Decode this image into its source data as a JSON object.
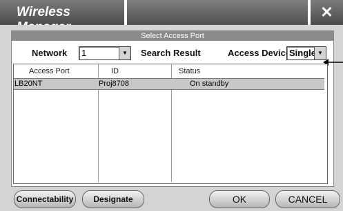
{
  "window": {
    "title": "Wireless Manager",
    "close_glyph": "✕"
  },
  "panel": {
    "header": "Select Access Port",
    "network_label": "Network",
    "network_value": "1",
    "search_label": "Search Result",
    "device_label": "Access Device",
    "device_value": "Single"
  },
  "list": {
    "columns": [
      "Access Port",
      "ID",
      "Status"
    ],
    "rows": [
      {
        "port": "LB20NT",
        "id": "Proj8708",
        "status": "On standby"
      }
    ]
  },
  "buttons": {
    "connectability": "Connectability",
    "designate": "Designate",
    "ok": "OK",
    "cancel": "CANCEL"
  },
  "icons": {
    "dropdown": "chevron-down-icon",
    "close": "close-icon",
    "pointer": "pointer-arrow-icon"
  }
}
